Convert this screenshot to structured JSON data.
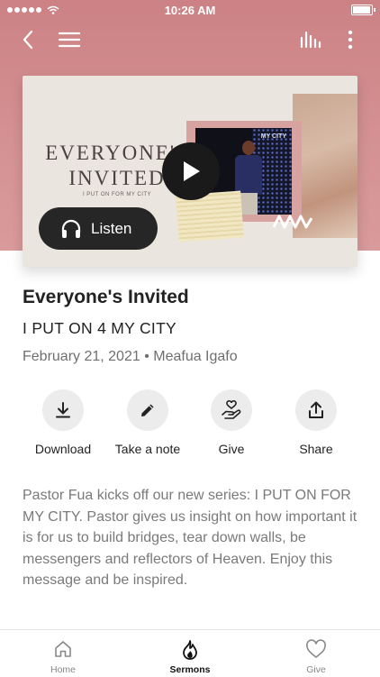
{
  "status_bar": {
    "time": "10:26 AM"
  },
  "colors": {
    "hero_background": "#d08a8c",
    "accent": "#262626"
  },
  "nav": {
    "back_icon": "chevron-left-icon",
    "menu_icon": "hamburger-menu-icon",
    "audio_icon": "equalizer-icon",
    "more_icon": "more-vertical-icon"
  },
  "artwork": {
    "title_line1": "EVERYONE'S",
    "title_line2": "INVITED",
    "subtitle": "I PUT ON FOR MY CITY",
    "screen_text": "MY CITY"
  },
  "listen_button": {
    "label": "Listen",
    "icon": "headphones-icon"
  },
  "sermon": {
    "title": "Everyone's Invited",
    "series": "I PUT ON 4 MY CITY",
    "meta": "February 21, 2021 • Meafua Igafo",
    "description": "Pastor Fua kicks off our new series: I PUT ON FOR MY CITY. Pastor gives us insight on how important it is for us to build bridges, tear down walls, be messengers and reflectors of Heaven. Enjoy this message and be inspired."
  },
  "actions": [
    {
      "label": "Download",
      "icon": "download-icon"
    },
    {
      "label": "Take a note",
      "icon": "pencil-icon"
    },
    {
      "label": "Give",
      "icon": "hand-heart-icon"
    },
    {
      "label": "Share",
      "icon": "share-icon"
    }
  ],
  "tabs": [
    {
      "label": "Home",
      "icon": "home-icon",
      "active": false
    },
    {
      "label": "Sermons",
      "icon": "flame-icon",
      "active": true
    },
    {
      "label": "Give",
      "icon": "heart-icon",
      "active": false
    }
  ]
}
